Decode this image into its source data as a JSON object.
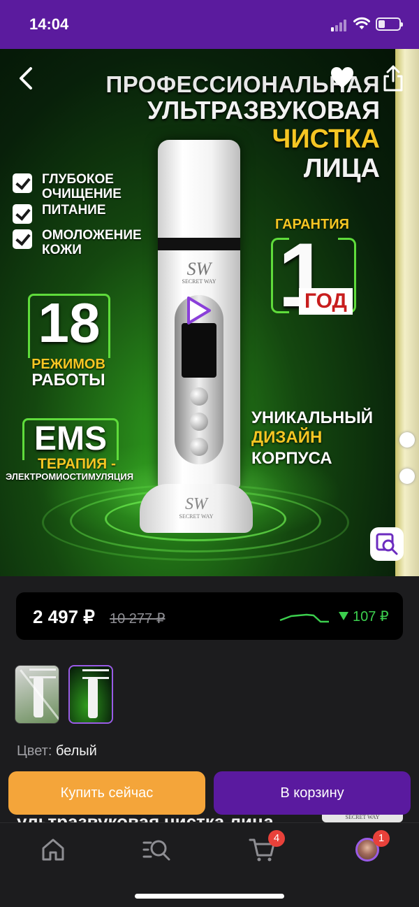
{
  "status_bar": {
    "time": "14:04"
  },
  "hero": {
    "title_line1": "ПРОФЕССИОНАЛЬНАЯ",
    "title_line2": "УЛЬТРАЗВУКОВАЯ",
    "title_line3": "ЧИСТКА",
    "title_line4": "ЛИЦА",
    "features": [
      "ГЛУБОКОЕ ОЧИЩЕНИЕ",
      "ПИТАНИЕ",
      "ОМОЛОЖЕНИЕ КОЖИ"
    ],
    "modes_count": "18",
    "modes_label": "РЕЖИМОВ",
    "modes_sub": "РАБОТЫ",
    "ems": "EMS",
    "ems_label": "ТЕРАПИЯ -",
    "ems_sub": "ЭЛЕКТРОМИОСТИМУЛЯЦИЯ",
    "guarantee_label": "ГАРАНТИЯ",
    "guarantee_value": "1",
    "guarantee_unit": "ГОД",
    "design_line1": "УНИКАЛЬНЫЙ",
    "design_line2": "ДИЗАЙН",
    "design_line3": "КОРПУСА",
    "device_logo": "SW",
    "device_brand": "SECRET WAY"
  },
  "price": {
    "current": "2 497 ₽",
    "old": "10 277 ₽",
    "drop": "107 ₽",
    "accent_color": "#3ccf4e"
  },
  "thumbnails": {
    "count": 2,
    "selected_index": 1
  },
  "color_option": {
    "label": "Цвет:",
    "value": "белый"
  },
  "actions": {
    "buy_now": "Купить сейчас",
    "add_to_cart": "В корзину"
  },
  "next_section": {
    "title_peek": "ультразвуковая чистка лица",
    "tag_peek": "SECRET WAY"
  },
  "tab_bar": {
    "items": [
      "home-icon",
      "catalog-search-icon",
      "cart-icon",
      "profile-avatar"
    ],
    "cart_badge": "4",
    "profile_badge": "1"
  },
  "colors": {
    "brand_purple": "#5b1b9e",
    "buy_orange": "#f4a53a",
    "highlight_yellow": "#f5c623"
  }
}
